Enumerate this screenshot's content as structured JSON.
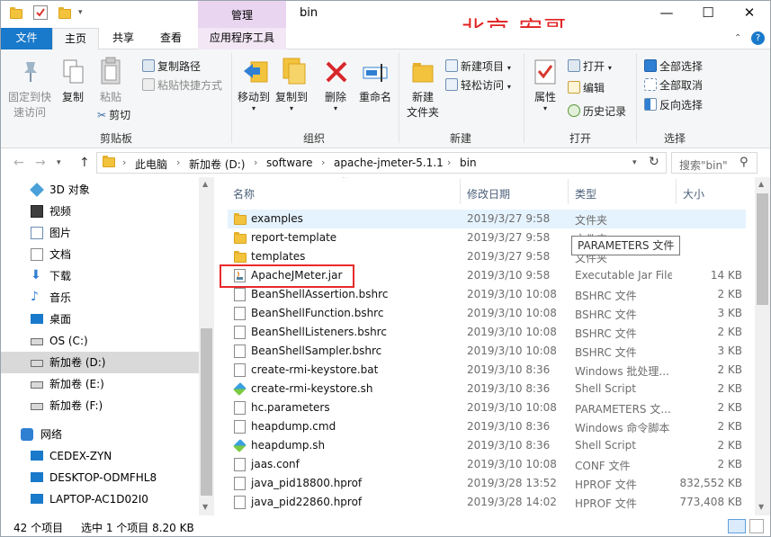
{
  "titlebar": {
    "title": "bin",
    "context_tab": "管理",
    "watermark": "北京-宏哥",
    "minimize": "—",
    "maximize": "☐",
    "close": "✕"
  },
  "tabs": [
    "文件",
    "主页",
    "共享",
    "查看",
    "应用程序工具"
  ],
  "ribbon": {
    "clipboard": {
      "label": "剪贴板",
      "pin": "固定到快速访问",
      "pin_line1": "固定到快",
      "pin_line2": "速访问",
      "copy": "复制",
      "paste": "粘贴",
      "copy_path": "复制路径",
      "paste_shortcut": "粘贴快捷方式",
      "cut": "剪切"
    },
    "organize": {
      "label": "组织",
      "move_to": "移动到",
      "copy_to": "复制到",
      "delete": "删除",
      "rename": "重命名"
    },
    "new": {
      "label": "新建",
      "new_folder_1": "新建",
      "new_folder_2": "文件夹",
      "new_item": "新建项目",
      "easy_access": "轻松访问"
    },
    "open": {
      "label": "打开",
      "properties": "属性",
      "open": "打开",
      "edit": "编辑",
      "history": "历史记录"
    },
    "select": {
      "label": "选择",
      "select_all": "全部选择",
      "select_none": "全部取消",
      "invert": "反向选择"
    }
  },
  "address": {
    "crumbs": [
      "此电脑",
      "新加卷 (D:)",
      "software",
      "apache-jmeter-5.1.1",
      "bin"
    ],
    "search_placeholder": "搜索\"bin\""
  },
  "nav": [
    {
      "label": "3D 对象",
      "icon": "3d-objects-icon",
      "selected": false
    },
    {
      "label": "视频",
      "icon": "video-icon",
      "selected": false
    },
    {
      "label": "图片",
      "icon": "pictures-icon",
      "selected": false
    },
    {
      "label": "文档",
      "icon": "documents-icon",
      "selected": false
    },
    {
      "label": "下载",
      "icon": "download-icon",
      "selected": false
    },
    {
      "label": "音乐",
      "icon": "music-icon",
      "selected": false
    },
    {
      "label": "桌面",
      "icon": "desktop-icon",
      "selected": false
    },
    {
      "label": "OS (C:)",
      "icon": "drive-icon",
      "selected": false
    },
    {
      "label": "新加卷 (D:)",
      "icon": "drive-icon",
      "selected": true
    },
    {
      "label": "新加卷 (E:)",
      "icon": "drive-icon",
      "selected": false
    },
    {
      "label": "新加卷 (F:)",
      "icon": "drive-icon",
      "selected": false
    },
    {
      "label": "网络",
      "icon": "network-icon",
      "selected": false
    },
    {
      "label": "CEDEX-ZYN",
      "icon": "computer-icon",
      "selected": false
    },
    {
      "label": "DESKTOP-ODMFHL8",
      "icon": "computer-icon",
      "selected": false
    },
    {
      "label": "LAPTOP-AC1D02I0",
      "icon": "computer-icon",
      "selected": false
    }
  ],
  "columns": {
    "name": "名称",
    "date": "修改日期",
    "type": "类型",
    "size": "大小"
  },
  "files": [
    {
      "name": "examples",
      "date": "2019/3/27 9:58",
      "type": "文件夹",
      "size": "",
      "icon": "folder"
    },
    {
      "name": "report-template",
      "date": "2019/3/27 9:58",
      "type": "文件夹",
      "size": "",
      "icon": "folder"
    },
    {
      "name": "templates",
      "date": "2019/3/27 9:58",
      "type": "文件夹",
      "size": "",
      "icon": "folder"
    },
    {
      "name": "ApacheJMeter.jar",
      "date": "2019/3/10 9:58",
      "type": "Executable Jar File",
      "size": "14 KB",
      "icon": "jar"
    },
    {
      "name": "BeanShellAssertion.bshrc",
      "date": "2019/3/10 10:08",
      "type": "BSHRC 文件",
      "size": "2 KB",
      "icon": "doc"
    },
    {
      "name": "BeanShellFunction.bshrc",
      "date": "2019/3/10 10:08",
      "type": "BSHRC 文件",
      "size": "3 KB",
      "icon": "doc"
    },
    {
      "name": "BeanShellListeners.bshrc",
      "date": "2019/3/10 10:08",
      "type": "BSHRC 文件",
      "size": "2 KB",
      "icon": "doc"
    },
    {
      "name": "BeanShellSampler.bshrc",
      "date": "2019/3/10 10:08",
      "type": "BSHRC 文件",
      "size": "3 KB",
      "icon": "doc"
    },
    {
      "name": "create-rmi-keystore.bat",
      "date": "2019/3/10 8:36",
      "type": "Windows 批处理...",
      "size": "2 KB",
      "icon": "gear"
    },
    {
      "name": "create-rmi-keystore.sh",
      "date": "2019/3/10 8:36",
      "type": "Shell Script",
      "size": "2 KB",
      "icon": "sh"
    },
    {
      "name": "hc.parameters",
      "date": "2019/3/10 10:08",
      "type": "PARAMETERS 文...",
      "size": "2 KB",
      "icon": "doc"
    },
    {
      "name": "heapdump.cmd",
      "date": "2019/3/10 8:36",
      "type": "Windows 命令脚本",
      "size": "2 KB",
      "icon": "gear"
    },
    {
      "name": "heapdump.sh",
      "date": "2019/3/10 8:36",
      "type": "Shell Script",
      "size": "2 KB",
      "icon": "sh"
    },
    {
      "name": "jaas.conf",
      "date": "2019/3/10 10:08",
      "type": "CONF 文件",
      "size": "2 KB",
      "icon": "doc"
    },
    {
      "name": "java_pid18800.hprof",
      "date": "2019/3/28 13:52",
      "type": "HPROF 文件",
      "size": "832,552 KB",
      "icon": "doc"
    },
    {
      "name": "java_pid22860.hprof",
      "date": "2019/3/28 14:02",
      "type": "HPROF 文件",
      "size": "773,408 KB",
      "icon": "doc"
    }
  ],
  "tooltip": "PARAMETERS 文件",
  "status": {
    "count": "42 个项目",
    "selection": "选中 1 个项目  8.20 KB"
  }
}
